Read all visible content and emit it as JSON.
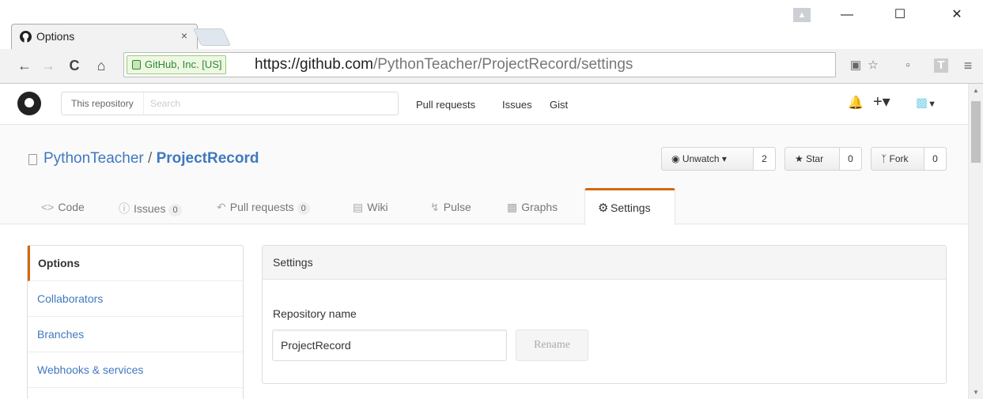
{
  "window": {
    "tab_title": "Options",
    "tab_close": "×",
    "controls": {
      "minimize": "—",
      "maximize": "☐",
      "close": "✕"
    }
  },
  "toolbar": {
    "ev_label": "GitHub, Inc. [US]",
    "url_prefix": "https://",
    "url_host": "github.com",
    "url_path": "/PythonTeacher/ProjectRecord/settings"
  },
  "header": {
    "search_scope": "This repository",
    "search_placeholder": "Search",
    "nav": [
      "Pull requests",
      "Issues",
      "Gist"
    ]
  },
  "repo": {
    "owner": "PythonTeacher",
    "separator": "/",
    "name": "ProjectRecord",
    "actions": {
      "watch": {
        "label": "Unwatch ▾",
        "count": "2"
      },
      "star": {
        "label": "Star",
        "count": "0"
      },
      "fork": {
        "label": "Fork",
        "count": "0"
      }
    },
    "tabs": [
      {
        "label": "Code",
        "icon": "code-icon"
      },
      {
        "label": "Issues",
        "count": "0",
        "icon": "issue-icon"
      },
      {
        "label": "Pull requests",
        "count": "0",
        "icon": "pull-request-icon"
      },
      {
        "label": "Wiki",
        "icon": "book-icon"
      },
      {
        "label": "Pulse",
        "icon": "pulse-icon"
      },
      {
        "label": "Graphs",
        "icon": "graph-icon"
      },
      {
        "label": "Settings",
        "icon": "gear-icon",
        "selected": true
      }
    ]
  },
  "sidebar": {
    "items": [
      "Options",
      "Collaborators",
      "Branches",
      "Webhooks & services"
    ]
  },
  "settings": {
    "title": "Settings",
    "repo_name_label": "Repository name",
    "repo_name_value": "ProjectRecord",
    "rename_label": "Rename"
  },
  "colors": {
    "accent": "#d26911",
    "link": "#4078c0"
  }
}
